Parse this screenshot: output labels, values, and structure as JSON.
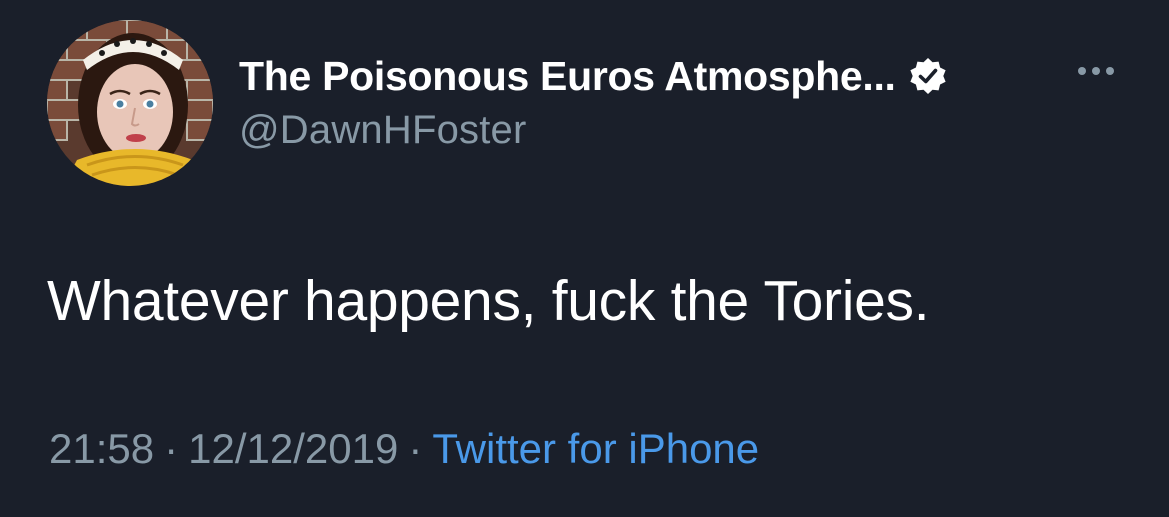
{
  "tweet": {
    "author": {
      "display_name": "The Poisonous Euros Atmosphe...",
      "handle": "@DawnHFoster",
      "verified": true
    },
    "text": "Whatever happens, fuck the Tories.",
    "time": "21:58",
    "separator": "·",
    "date": "12/12/2019",
    "source": "Twitter for iPhone"
  },
  "icons": {
    "verified": "verified-badge-icon",
    "more": "more-options-icon"
  },
  "colors": {
    "background": "#1a1f2a",
    "text": "#ffffff",
    "secondary_text": "#8899a6",
    "link": "#4a99e9"
  }
}
